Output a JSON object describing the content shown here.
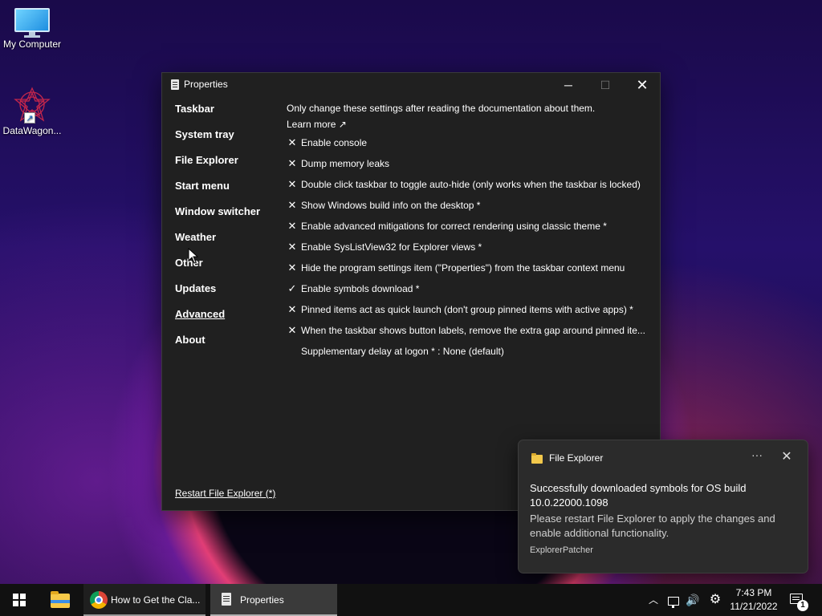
{
  "desktop": {
    "icons": [
      {
        "label": "My Computer",
        "icon": "monitor-icon"
      },
      {
        "label": "DataWagon...",
        "icon": "datawagon-logo-icon"
      }
    ]
  },
  "window": {
    "title": "Properties",
    "minimize_glyph": "─",
    "maximize_glyph": "☐",
    "close_glyph": "✕",
    "nav": [
      {
        "label": "Taskbar"
      },
      {
        "label": "System tray"
      },
      {
        "label": "File Explorer"
      },
      {
        "label": "Start menu"
      },
      {
        "label": "Window switcher"
      },
      {
        "label": "Weather"
      },
      {
        "label": "Other"
      },
      {
        "label": "Updates"
      },
      {
        "label": "Advanced",
        "active": true
      },
      {
        "label": "About"
      }
    ],
    "restart_link": "Restart File Explorer (*)",
    "note": "Only change these settings after reading the documentation about them.",
    "learn_more": "Learn more ↗",
    "options": [
      {
        "mark": "✕",
        "label": "Enable console"
      },
      {
        "mark": "✕",
        "label": "Dump memory leaks"
      },
      {
        "mark": "✕",
        "label": "Double click taskbar to toggle auto-hide (only works when the taskbar is locked)"
      },
      {
        "mark": "✕",
        "label": "Show Windows build info on the desktop *"
      },
      {
        "mark": "✕",
        "label": "Enable advanced mitigations for correct rendering using classic theme *"
      },
      {
        "mark": "✕",
        "label": "Enable SysListView32 for Explorer views *"
      },
      {
        "mark": "✕",
        "label": "Hide the program settings item (\"Properties\") from the taskbar context menu"
      },
      {
        "mark": "✓",
        "label": "Enable symbols download *"
      },
      {
        "mark": "✕",
        "label": "Pinned items act as quick launch (don't group pinned items with active apps) *"
      },
      {
        "mark": "✕",
        "label": "When the taskbar shows button labels, remove the extra gap around pinned ite..."
      }
    ],
    "delay_setting": "Supplementary delay at logon * : None (default)"
  },
  "toast": {
    "app": "File Explorer",
    "more_glyph": "···",
    "close_glyph": "✕",
    "title": "Successfully downloaded symbols for OS build 10.0.22000.1098",
    "body": "Please restart File Explorer to apply the changes and enable additional functionality.",
    "source": "ExplorerPatcher"
  },
  "taskbar": {
    "tasks": [
      {
        "label": "How to Get the Cla...",
        "icon": "chrome-icon"
      },
      {
        "label": "Properties",
        "icon": "properties-icon"
      }
    ],
    "tray": {
      "chevron_glyph": "︿",
      "volume_glyph": "🔊",
      "settings_glyph": "⚙"
    },
    "clock": {
      "time": "7:43 PM",
      "date": "11/21/2022"
    },
    "notifications_count": "1"
  },
  "colors": {
    "window_bg": "#202020",
    "toast_bg": "#2b2b2b",
    "taskbar_bg": "#111111",
    "accent_folder": "#f7c948"
  }
}
